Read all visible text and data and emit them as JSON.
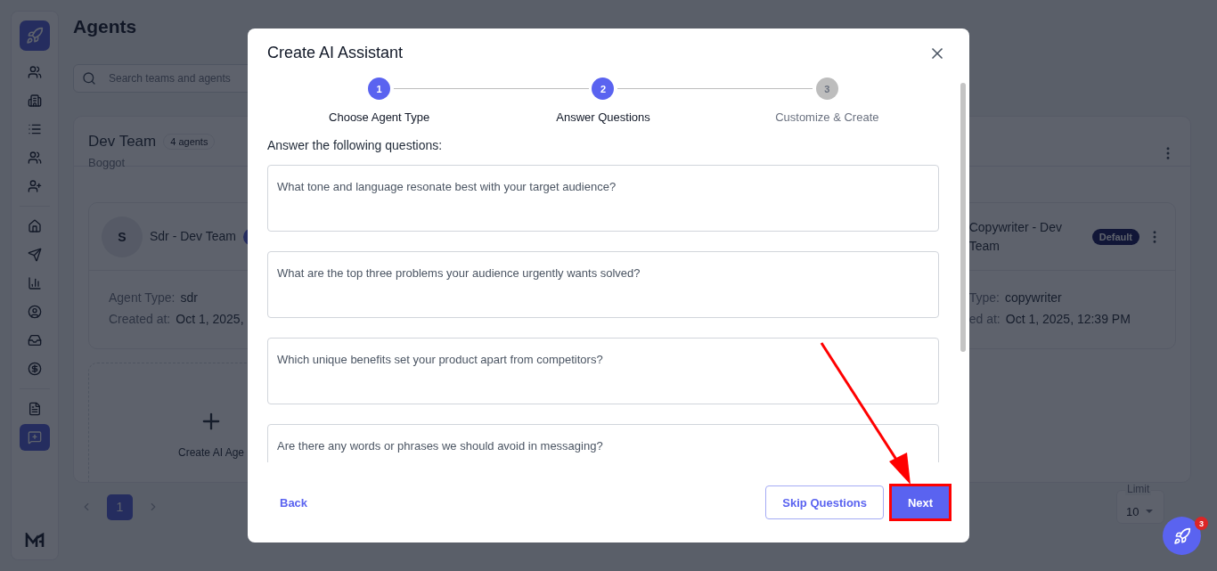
{
  "sidebar": {
    "groups": [
      [
        {
          "selected": false
        },
        {
          "selected": false
        },
        {
          "selected": false
        },
        {
          "selected": false
        },
        {
          "selected": false
        }
      ],
      [
        {
          "selected": false
        },
        {
          "selected": false
        },
        {
          "selected": false
        },
        {
          "selected": false
        },
        {
          "selected": false
        },
        {
          "selected": false
        }
      ],
      [
        {
          "selected": false
        },
        {
          "selected": true
        }
      ]
    ]
  },
  "page": {
    "title": "Agents",
    "search": {
      "placeholder": "Search teams and agents"
    }
  },
  "team": {
    "name": "Dev Team",
    "count": "4 agents",
    "location": "Boggot",
    "agents": [
      {
        "kind": "left",
        "initial": "S",
        "name": "Sdr - Dev Team",
        "fields": [
          {
            "label": "Agent Type:",
            "value": "sdr"
          },
          {
            "label": "Created at:",
            "value": "Oct 1, 2025,"
          }
        ]
      },
      {
        "kind": "right",
        "name": "Copywriter - Dev Team",
        "badge": "Default",
        "fields": [
          {
            "label": "Type:",
            "value": "copywriter"
          },
          {
            "label": "ed at:",
            "value": "Oct 1, 2025, 12:39 PM"
          }
        ]
      }
    ],
    "create_label": "Create AI Age"
  },
  "pagination": {
    "pages": [
      {
        "label": "1",
        "selected": true
      }
    ],
    "limit_label": "Limit",
    "limit_value": "10"
  },
  "fab": {
    "badge": "3"
  },
  "modal": {
    "title": "Create AI Assistant",
    "steps": [
      {
        "number": "1",
        "label": "Choose Agent Type",
        "reached": true
      },
      {
        "number": "2",
        "label": "Answer Questions",
        "reached": true
      },
      {
        "number": "3",
        "label": "Customize & Create",
        "reached": false
      }
    ],
    "intro": "Answer the following questions:",
    "questions": [
      {
        "placeholder": "What tone and language resonate best with your target audience?"
      },
      {
        "placeholder": "What are the top three problems your audience urgently wants solved?"
      },
      {
        "placeholder": "Which unique benefits set your product apart from competitors?"
      },
      {
        "placeholder": "Are there any words or phrases we should avoid in messaging?"
      }
    ],
    "back": "Back",
    "skip": "Skip Questions",
    "next": {
      "label": "Next",
      "highlighted": true
    }
  }
}
